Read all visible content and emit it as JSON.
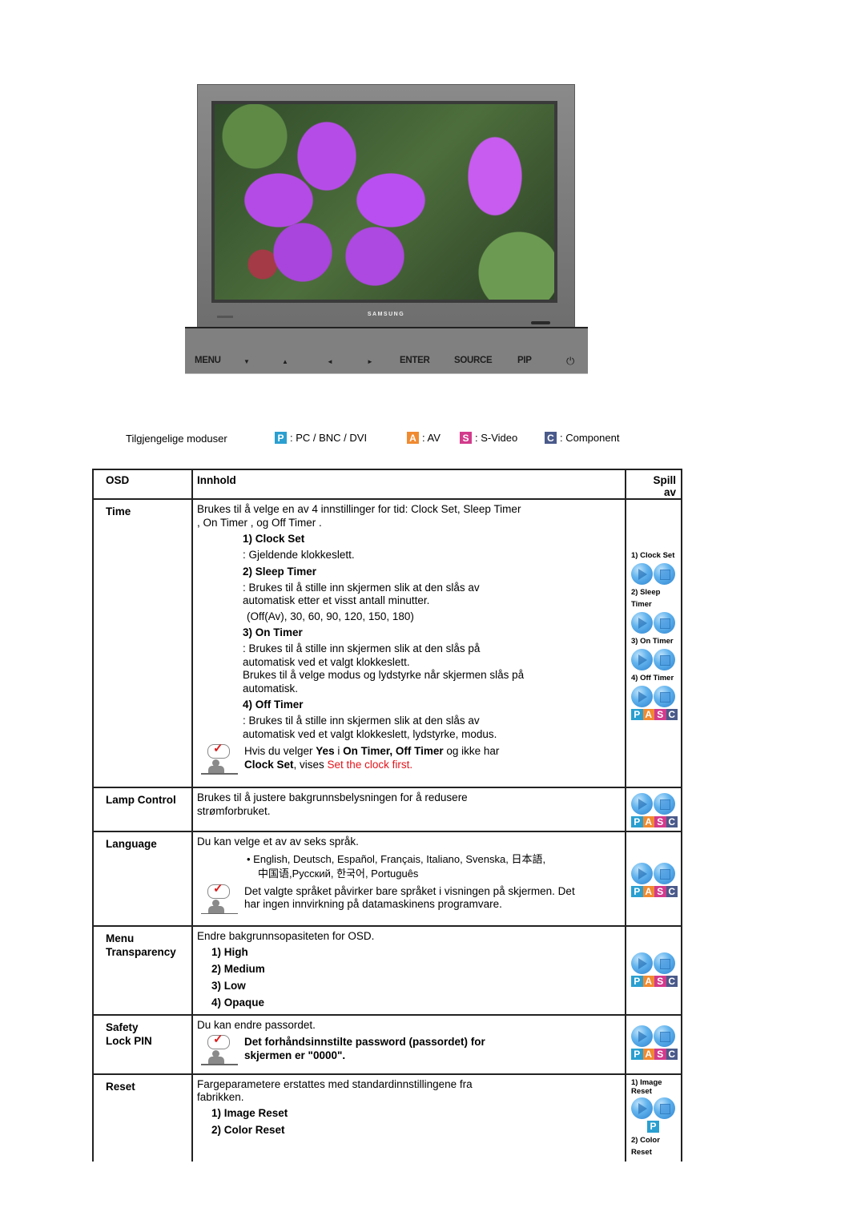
{
  "monitor": {
    "brand": "SAMSUNG",
    "controls": [
      "MENU",
      "▼",
      "▲",
      "◄",
      "►",
      "ENTER",
      "SOURCE",
      "PIP"
    ],
    "power_icon": "power-icon"
  },
  "legend": {
    "label": "Tilgjengelige moduser",
    "modes": [
      {
        "badge": "P",
        "text": ": PC / BNC / DVI",
        "color": "#2a9fd0"
      },
      {
        "badge": "A",
        "text": ": AV",
        "color": "#f08a30"
      },
      {
        "badge": "S",
        "text": ": S-Video",
        "color": "#d23b8c"
      },
      {
        "badge": "C",
        "text": ": Component",
        "color": "#4a5a8a"
      }
    ]
  },
  "table": {
    "headers": {
      "osd": "OSD",
      "content": "Innhold",
      "play": "Spill av"
    },
    "rows": {
      "time": {
        "name": "Time",
        "intro": "Brukes til å velge en av 4 innstillinger for tid: Clock Set, Sleep Timer , On Timer , og Off Timer .",
        "items": [
          {
            "title": "1) Clock Set",
            "desc": ": Gjeldende klokkeslett."
          },
          {
            "title": "2) Sleep Timer",
            "desc": ": Brukes til å stille inn skjermen slik at den slås av automatisk etter et visst antall minutter.",
            "extra": "(Off(Av), 30, 60, 90, 120, 150, 180)"
          },
          {
            "title": "3) On Timer",
            "desc": ": Brukes til å stille inn skjermen slik at den slås på automatisk ved et valgt klokkeslett.",
            "extra2": "Brukes til å velge modus og lydstyrke når skjermen slås på automatisk."
          },
          {
            "title": "4) Off Timer",
            "desc": ": Brukes til å stille inn skjermen slik at den slås av automatisk ved et valgt klokkeslett, lydstyrke, modus."
          }
        ],
        "note": {
          "p1": "Hvis du velger ",
          "b1": "Yes",
          "p2": " i ",
          "b2": "On Timer, Off Timer",
          "p3": " og ikke har ",
          "b3": "Clock Set",
          "p4": ", vises ",
          "red": "Set the clock first."
        },
        "play_labels": [
          "1) Clock Set",
          "2) Sleep Timer",
          "3) On Timer",
          "4) Off Timer"
        ]
      },
      "lamp": {
        "name": "Lamp Control",
        "desc": "Brukes til å justere bakgrunnsbelysningen for å redusere strømforbruket."
      },
      "language": {
        "name": "Language",
        "desc": "Du kan velge et av av seks språk.",
        "list_line1": "• English, Deutsch, Español, Français, Italiano, Svenska, 日本語,",
        "list_line2": "中国语,Русский, 한국어,  Português",
        "note": "Det valgte språket påvirker bare språket i visningen på skjermen. Det har ingen innvirkning på datamaskinens programvare."
      },
      "transparency": {
        "name": "Menu Transparency",
        "desc": "Endre bakgrunnsopasiteten for OSD.",
        "options": [
          "1) High",
          "2) Medium",
          "3) Low",
          "4) Opaque"
        ]
      },
      "safety": {
        "name": "Safety Lock PIN",
        "desc": "Du kan endre passordet.",
        "note": "Det forhåndsinnstilte password (passordet) for skjermen er \"0000\"."
      },
      "reset": {
        "name": "Reset",
        "desc": "Fargeparametere erstattes med standardinnstillingene fra fabrikken.",
        "options": [
          "1) Image Reset",
          "2) Color Reset"
        ],
        "play_labels": [
          "1) Image Reset",
          "2) Color Reset"
        ]
      }
    },
    "pasc": [
      "P",
      "A",
      "S",
      "C"
    ]
  }
}
